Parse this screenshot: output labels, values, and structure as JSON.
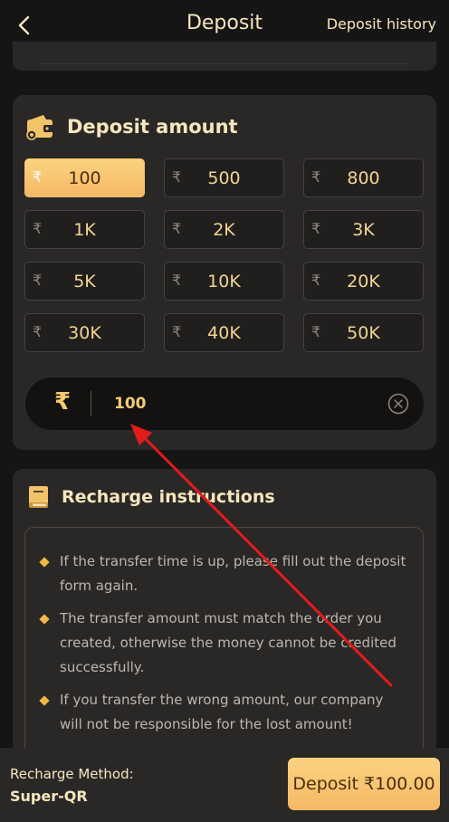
{
  "header": {
    "title": "Deposit",
    "history_link": "Deposit history"
  },
  "amount_section": {
    "title": "Deposit amount",
    "currency_symbol": "₹",
    "options": [
      "100",
      "500",
      "800",
      "1K",
      "2K",
      "3K",
      "5K",
      "10K",
      "20K",
      "30K",
      "40K",
      "50K"
    ],
    "selected_index": 0,
    "input_value": "100"
  },
  "instructions": {
    "title": "Recharge instructions",
    "items": [
      "If the transfer time is up, please fill out the deposit form again.",
      "The transfer amount must match the order you created, otherwise the money cannot be credited successfully.",
      "If you transfer the wrong amount, our company will not be responsible for the lost amount!"
    ]
  },
  "footer": {
    "method_label": "Recharge Method:",
    "method_value": "Super-QR",
    "deposit_button": "Deposit ₹100.00"
  },
  "colors": {
    "background": "#161515",
    "card": "#2a2827",
    "accent_gold": "#f6b864",
    "accent_gold_light": "#fbd381",
    "text_cream": "#f6e6bd",
    "annotation_red": "#e31b1b"
  },
  "icons": {
    "back": "chevron-left-icon",
    "wallet": "wallet-icon",
    "book": "book-icon",
    "clear": "clear-circle-icon",
    "diamond": "diamond-bullet-icon"
  }
}
